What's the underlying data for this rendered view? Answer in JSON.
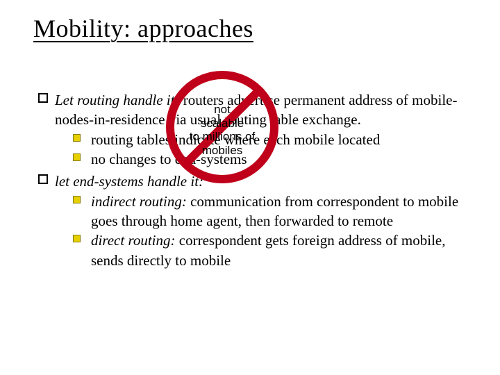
{
  "title": "Mobility: approaches",
  "bullets": [
    {
      "prefix_em": "Let routing handle it:",
      "rest": " routers advertise permanent address of mobile-nodes-in-residence via usual routing table exchange.",
      "subs": [
        {
          "text": "routing tables indicate where each mobile located"
        },
        {
          "text": "no changes to end-systems"
        }
      ]
    },
    {
      "prefix_em": "let end-systems handle it:",
      "rest": "",
      "subs": [
        {
          "em": "indirect routing:",
          "text": " communication from correspondent to mobile goes through home agent, then forwarded to remote"
        },
        {
          "em": "direct routing:",
          "text": " correspondent gets foreign address of mobile, sends directly to mobile"
        }
      ]
    }
  ],
  "stamp": {
    "line1": "not",
    "line2": "scalable",
    "line3": "to millions of",
    "line4": "mobiles"
  }
}
